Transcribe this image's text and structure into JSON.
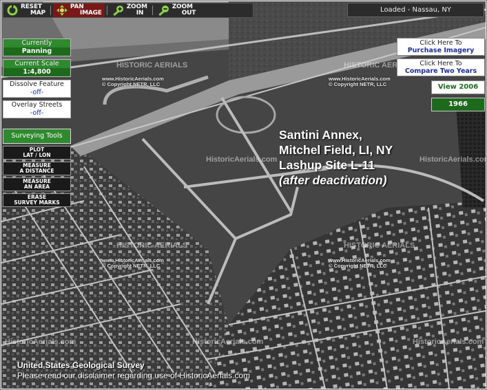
{
  "toolbar": {
    "reset_l1": "RESET",
    "reset_l2": "MAP",
    "pan_l1": "PAN",
    "pan_l2": "IMAGE",
    "zoomin_l1": "ZOOM",
    "zoomin_l2": "IN",
    "zoomout_l1": "ZOOM",
    "zoomout_l2": "OUT"
  },
  "status": "Loaded - Nassau, NY",
  "left_panel": {
    "mode_label": "Currently",
    "mode_value": "Panning",
    "scale_label": "Current Scale",
    "scale_value": "1:4,800",
    "dissolve_label": "Dissolve Feature",
    "dissolve_value": "-off-",
    "overlay_label": "Overlay Streets",
    "overlay_value": "-off-",
    "surveying_title": "Surveying Tools",
    "tools": [
      {
        "l1": "PLOT",
        "l2": "LAT / LON"
      },
      {
        "l1": "MEASURE",
        "l2": "A DISTANCE"
      },
      {
        "l1": "MEASURE",
        "l2": "AN AREA"
      },
      {
        "l1": "ERASE",
        "l2": "SURVEY MARKS"
      }
    ]
  },
  "right_panel": {
    "purchase_l1": "Click Here To",
    "purchase_l2": "Purchase Imagery",
    "compare_l1": "Click Here To",
    "compare_l2": "Compare Two Years",
    "view_year": "View 2006",
    "current_year": "1966"
  },
  "annotation": {
    "line1": "Santini Annex,",
    "line2": "Mitchel Field, LI, NY",
    "line3": "Lashup Site L-11",
    "line4": "(after deactivation)"
  },
  "watermark": {
    "brand": "HISTORIC AERIALS",
    "brand_alt": "HistoricAerials.com",
    "url": "www.HistoricAerials.com",
    "copyright": "© Copyright NETR, LLC"
  },
  "footer": {
    "line1": "United States Geological Survey",
    "line2": "Please read our disclaimer regarding use of HistoricAerials.com"
  },
  "colors": {
    "panel_green": "#1d6a1d",
    "active_tool": "#7a1818",
    "link_blue": "#1c2f9c"
  }
}
